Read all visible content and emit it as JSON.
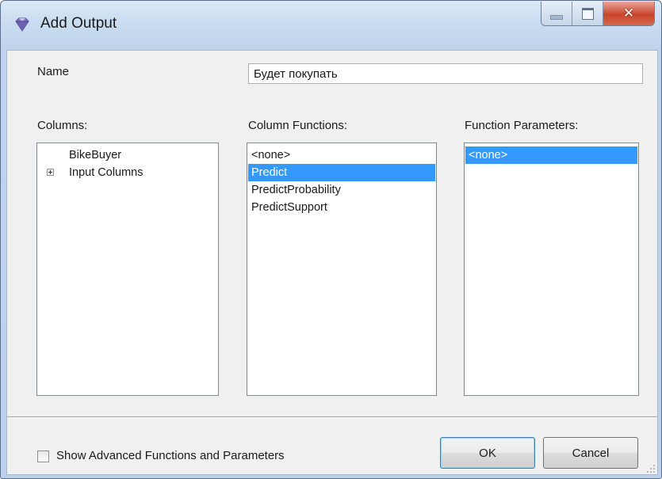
{
  "window": {
    "title": "Add Output",
    "controls": {
      "minimize": "minimize",
      "maximize": "maximize",
      "close": "close"
    }
  },
  "name_field": {
    "label": "Name",
    "value": "Будет покупать"
  },
  "columns": {
    "label": "Columns:",
    "items": [
      {
        "label": "BikeBuyer",
        "expandable": false
      },
      {
        "label": "Input Columns",
        "expandable": true
      }
    ]
  },
  "column_functions": {
    "label": "Column Functions:",
    "items": [
      "<none>",
      "Predict",
      "PredictProbability",
      "PredictSupport"
    ],
    "selected": "Predict"
  },
  "function_parameters": {
    "label": "Function Parameters:",
    "items": [
      "<none>"
    ],
    "selected": "<none>"
  },
  "show_advanced": {
    "label": "Show Advanced Functions and Parameters",
    "checked": false
  },
  "buttons": {
    "ok": "OK",
    "cancel": "Cancel"
  },
  "colors": {
    "selection": "#3399ff",
    "close_button": "#c9442b",
    "title_bar": "#c9dcf0"
  },
  "icons": {
    "app": "gem-icon",
    "tree_expand": "plus-box-icon",
    "resize": "resize-grip-icon"
  }
}
